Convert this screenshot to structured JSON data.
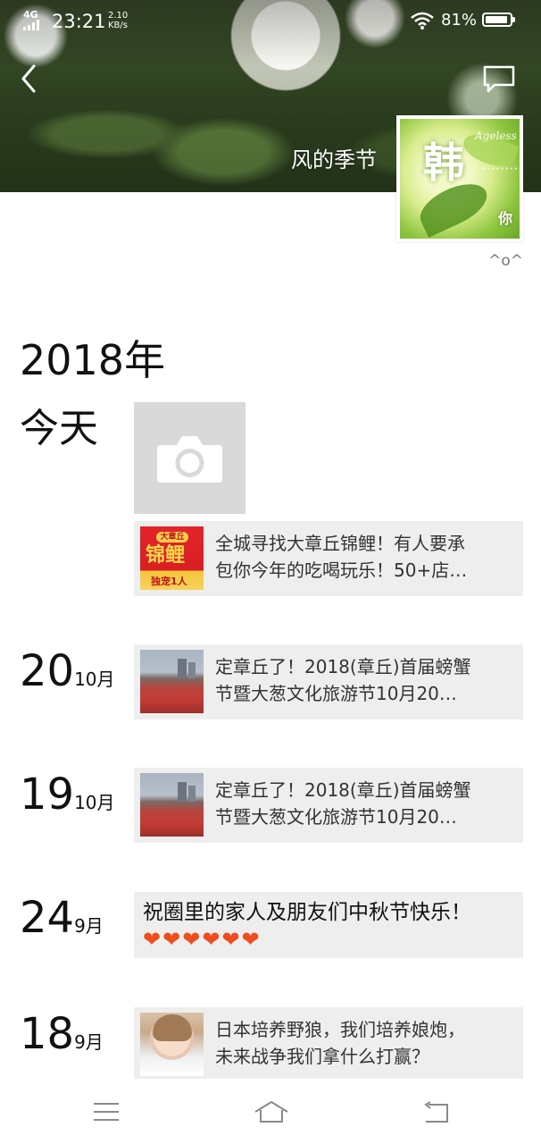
{
  "status_bar": {
    "network": "4G",
    "time": "23:21",
    "speed_value": "2.10",
    "speed_unit": "KB/s",
    "battery_percent": "81%"
  },
  "profile": {
    "username": "风的季节",
    "signature": "^o^",
    "avatar_char": "韩",
    "avatar_sig": "你",
    "avatar_script": "Ageless",
    "avatar_tiny": "••••••••••"
  },
  "timeline": {
    "year": "2018年",
    "today_label": "今天",
    "entries": [
      {
        "thumb": {
          "top_text": "大章丘",
          "title": "锦鲤",
          "bottom_text": "独宠1人"
        },
        "text_line1": "全城寻找大章丘锦鲤！有人要承",
        "text_line2": "包你今年的吃喝玩乐！50+店…"
      },
      {
        "day": "20",
        "month": "10月",
        "text_line1": "定章丘了！2018(章丘)首届螃蟹",
        "text_line2": "节暨大葱文化旅游节10月20…"
      },
      {
        "day": "19",
        "month": "10月",
        "text_line1": "定章丘了！2018(章丘)首届螃蟹",
        "text_line2": "节暨大葱文化旅游节10月20…"
      },
      {
        "day": "24",
        "month": "9月",
        "text_line1": "祝圈里的家人及朋友们中秋节快乐！",
        "hearts": "❤❤❤❤❤❤"
      },
      {
        "day": "18",
        "month": "9月",
        "text_line1": "日本培养野狼，我们培养娘炮，",
        "text_line2": "未来战争我们拿什么打赢？"
      }
    ]
  },
  "icons": {
    "back": "back-chevron-icon",
    "message": "message-icon",
    "camera": "camera-icon",
    "menu": "menu-icon",
    "home": "home-icon",
    "return": "return-icon"
  },
  "colors": {
    "card_bg": "#eeeeee",
    "camera_bg": "#d9d9d9",
    "heart": "#ee4d1d"
  }
}
